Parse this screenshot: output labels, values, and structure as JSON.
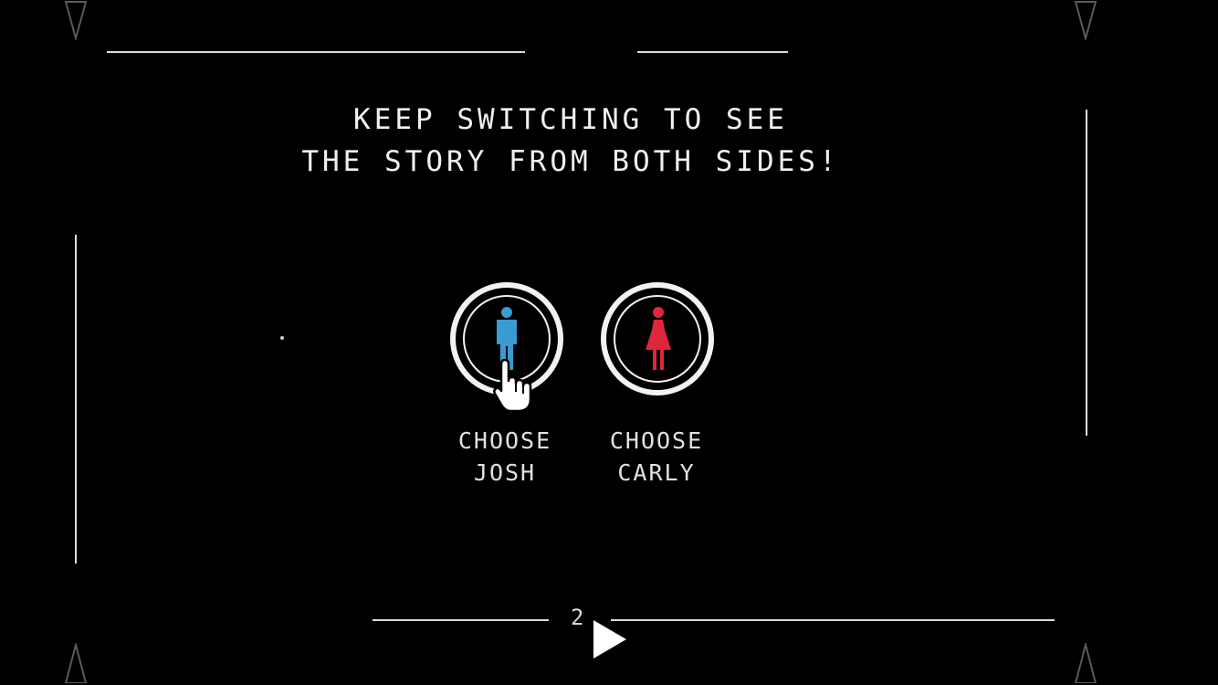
{
  "headline": {
    "line1": "KEEP SWITCHING TO SEE",
    "line2": "THE STORY FROM BOTH SIDES!"
  },
  "choices": [
    {
      "line1": "CHOOSE",
      "line2": "JOSH",
      "color": "#3a9ad2",
      "icon": "man-icon"
    },
    {
      "line1": "CHOOSE",
      "line2": "CARLY",
      "color": "#e0263d",
      "icon": "woman-icon"
    }
  ],
  "pagination": {
    "page": "2"
  },
  "colors": {
    "background": "#000000",
    "frame": "#dcdcdc",
    "text": "#f0f0f0"
  },
  "icons": [
    "corner-triangle-icon",
    "hand-pointer-icon",
    "play-icon"
  ]
}
